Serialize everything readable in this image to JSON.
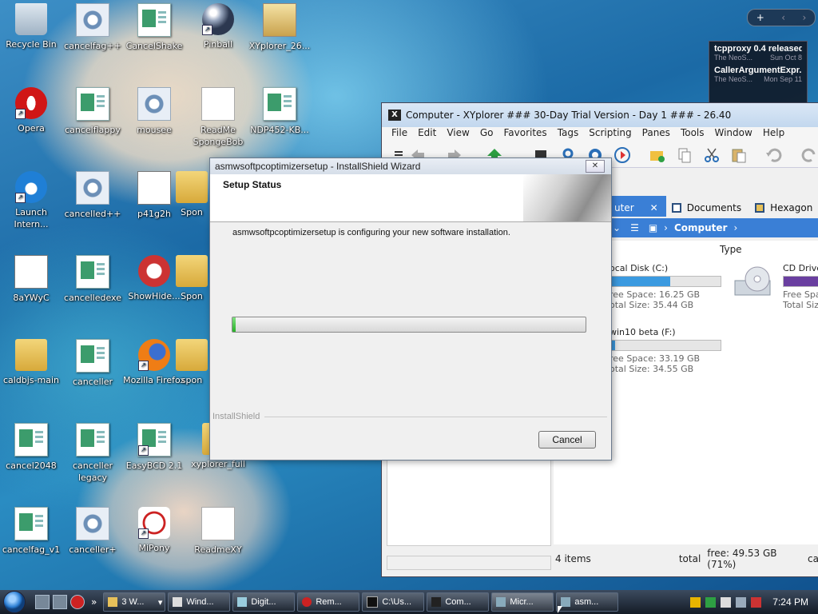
{
  "desktop": {
    "icons": [
      {
        "label": "Recycle Bin"
      },
      {
        "label": "cancelfag++"
      },
      {
        "label": "CancelShake"
      },
      {
        "label": "Pinball"
      },
      {
        "label": "XYplorer_26..."
      },
      {
        "label": "Opera"
      },
      {
        "label": "cancelflappy"
      },
      {
        "label": "mousee"
      },
      {
        "label": "ReadMe SpongeBob"
      },
      {
        "label": "NDP452-KB..."
      },
      {
        "label": "Launch Intern..."
      },
      {
        "label": "cancelled++"
      },
      {
        "label": "p41g2h"
      },
      {
        "label": "Spon"
      },
      {
        "label": "8aYWyC"
      },
      {
        "label": "cancelledexe"
      },
      {
        "label": "ShowHide..."
      },
      {
        "label": "Spon"
      },
      {
        "label": "caldbjs-main"
      },
      {
        "label": "canceller"
      },
      {
        "label": "Mozilla Firefox"
      },
      {
        "label": "spon"
      },
      {
        "label": "cancel2048"
      },
      {
        "label": "canceller legacy"
      },
      {
        "label": "EasyBCD 2.1"
      },
      {
        "label": "xyplorer_full"
      },
      {
        "label": "cancelfag_v1"
      },
      {
        "label": "canceller+"
      },
      {
        "label": "MiPony"
      },
      {
        "label": "ReadmeXY"
      }
    ]
  },
  "gadget": {
    "add": "+",
    "prev": "‹",
    "next": "›",
    "feed": [
      {
        "title": "tcpproxy 0.4 released",
        "source": "The NeoS...",
        "date": "Sun Oct 8"
      },
      {
        "title": "CallerArgumentExpr...",
        "source": "The NeoS...",
        "date": "Mon Sep 11"
      }
    ]
  },
  "xyplorer": {
    "title": "Computer - XYplorer ### 30-Day Trial Version - Day 1 ### - 26.40",
    "menu": [
      "File",
      "Edit",
      "View",
      "Go",
      "Favorites",
      "Tags",
      "Scripting",
      "Panes",
      "Tools",
      "Window",
      "Help"
    ],
    "tabs": [
      {
        "label": "uter",
        "active": true
      },
      {
        "label": "Documents",
        "active": false
      },
      {
        "label": "Hexagon",
        "active": false
      }
    ],
    "path": "Computer",
    "columns": [
      "Type"
    ],
    "drives": [
      {
        "name": "ocal Disk (C:)",
        "free": "ree Space: 16.25 GB",
        "total": "otal Size: 35.44 GB",
        "used_fraction": 0.54
      },
      {
        "name": "win10 beta (F:)",
        "free": "ree Space: 33.19 GB",
        "total": "otal Size: 34.55 GB",
        "used_fraction": 0.04
      },
      {
        "name": "CD Drive",
        "free": "Free Spa",
        "total": "Total Siz",
        "used_fraction": 1.0
      }
    ],
    "status": {
      "items": "4 items",
      "total": "total",
      "free": "free: 49.53 GB (71%)",
      "extra": "ca"
    }
  },
  "dialog": {
    "title": "asmwsoftpcoptimizersetup - InstallShield Wizard",
    "close": "✕",
    "header": "Setup Status",
    "message": "asmwsoftpcoptimizersetup is configuring your new software installation.",
    "progress_fraction": 0.01,
    "brand": "InstallShield",
    "cancel": "Cancel"
  },
  "taskbar": {
    "tasks": [
      {
        "label": "3 W..."
      },
      {
        "label": "Wind..."
      },
      {
        "label": "Digit..."
      },
      {
        "label": "Rem..."
      },
      {
        "label": "C:\\Us..."
      },
      {
        "label": "Com..."
      },
      {
        "label": "Micr..."
      },
      {
        "label": "asm..."
      }
    ],
    "clock": "7:24 PM"
  },
  "colors": {
    "accent": "#3a7fd6",
    "progress": "#27b027",
    "drive_bar": "#3b9ae0",
    "cd_bar": "#6a3fa0"
  }
}
